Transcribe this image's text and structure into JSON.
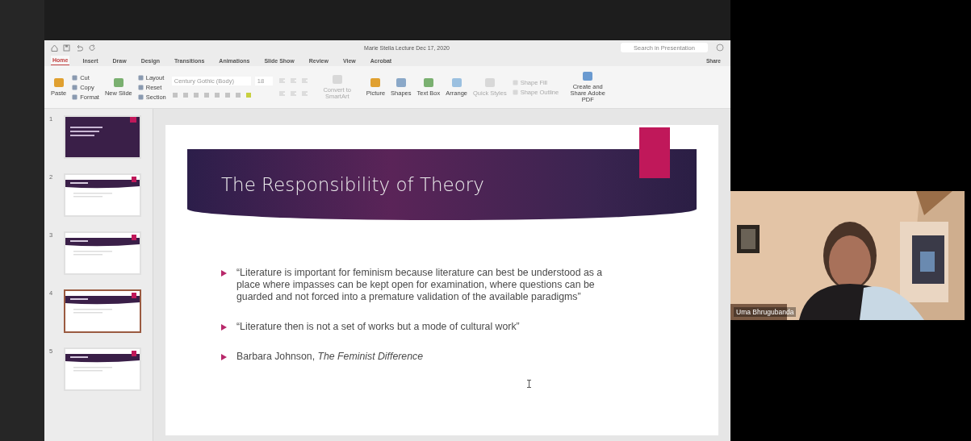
{
  "app_window": {
    "title": "Marie Stella Lecture Dec 17, 2020",
    "search": {
      "placeholder": "Search in Presentation"
    },
    "share_button": "Share",
    "tabs": [
      {
        "label": "Home",
        "selected": true
      },
      {
        "label": "Insert",
        "selected": false
      },
      {
        "label": "Draw",
        "selected": false
      },
      {
        "label": "Design",
        "selected": false
      },
      {
        "label": "Transitions",
        "selected": false
      },
      {
        "label": "Animations",
        "selected": false
      },
      {
        "label": "Slide Show",
        "selected": false
      },
      {
        "label": "Review",
        "selected": false
      },
      {
        "label": "View",
        "selected": false
      },
      {
        "label": "Acrobat",
        "selected": false
      }
    ],
    "ribbon": [
      {
        "kind": "large",
        "label": "Paste",
        "disabled": false
      },
      {
        "kind": "stack",
        "items": [
          {
            "label": "Cut",
            "disabled": false
          },
          {
            "label": "Copy",
            "disabled": false
          },
          {
            "label": "Format",
            "disabled": false
          }
        ]
      },
      {
        "kind": "large",
        "label": "New Slide",
        "disabled": false
      },
      {
        "kind": "stack",
        "items": [
          {
            "label": "Layout",
            "disabled": false
          },
          {
            "label": "Reset",
            "disabled": false
          },
          {
            "label": "Section",
            "disabled": false
          }
        ]
      },
      {
        "kind": "font",
        "font": "Century Gothic (Body)",
        "size": "18"
      },
      {
        "kind": "paragraph"
      },
      {
        "kind": "large",
        "label": "Convert to SmartArt",
        "disabled": true
      },
      {
        "kind": "large",
        "label": "Picture",
        "disabled": false
      },
      {
        "kind": "large",
        "label": "Shapes",
        "disabled": false
      },
      {
        "kind": "large",
        "label": "Text Box",
        "disabled": false
      },
      {
        "kind": "large",
        "label": "Arrange",
        "disabled": false
      },
      {
        "kind": "large",
        "label": "Quick Styles",
        "disabled": true
      },
      {
        "kind": "stack",
        "items": [
          {
            "label": "Shape Fill",
            "disabled": true
          },
          {
            "label": "Shape Outline",
            "disabled": true
          }
        ]
      },
      {
        "kind": "large",
        "label": "Create and Share Adobe PDF",
        "disabled": false
      }
    ],
    "thumbnails": [
      {
        "number": "1",
        "kind": "title",
        "selected": false
      },
      {
        "number": "2",
        "kind": "content",
        "selected": false
      },
      {
        "number": "3",
        "kind": "content",
        "selected": false
      },
      {
        "number": "4",
        "kind": "content",
        "selected": true
      },
      {
        "number": "5",
        "kind": "content",
        "selected": false
      }
    ],
    "slide": {
      "title": "The Responsibility of Theory",
      "bullets": [
        "“Literature is important for feminism because literature can best be understood as a place where impasses can be kept open for examination, where questions can be guarded and not forced into a premature validation of the available paradigms”",
        "“Literature then is not a set of works but a mode of cultural work”",
        "Barbara Johnson, *The Feminist Difference*"
      ]
    }
  },
  "participant": {
    "name": "Uma Bhrugubanda"
  }
}
